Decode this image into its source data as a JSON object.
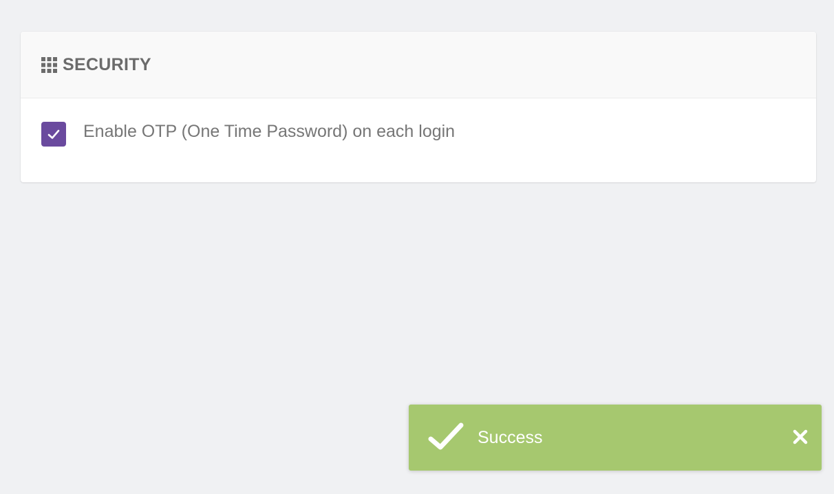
{
  "security_card": {
    "title": "SECURITY",
    "header_icon": "grid-icon",
    "option": {
      "label": "Enable OTP (One Time Password) on each login",
      "checked": true,
      "checkbox_color": "#6a4a9e"
    }
  },
  "toast": {
    "message": "Success",
    "status_icon": "checkmark-icon",
    "close_icon": "close-icon",
    "background_color": "#a6c86f"
  }
}
